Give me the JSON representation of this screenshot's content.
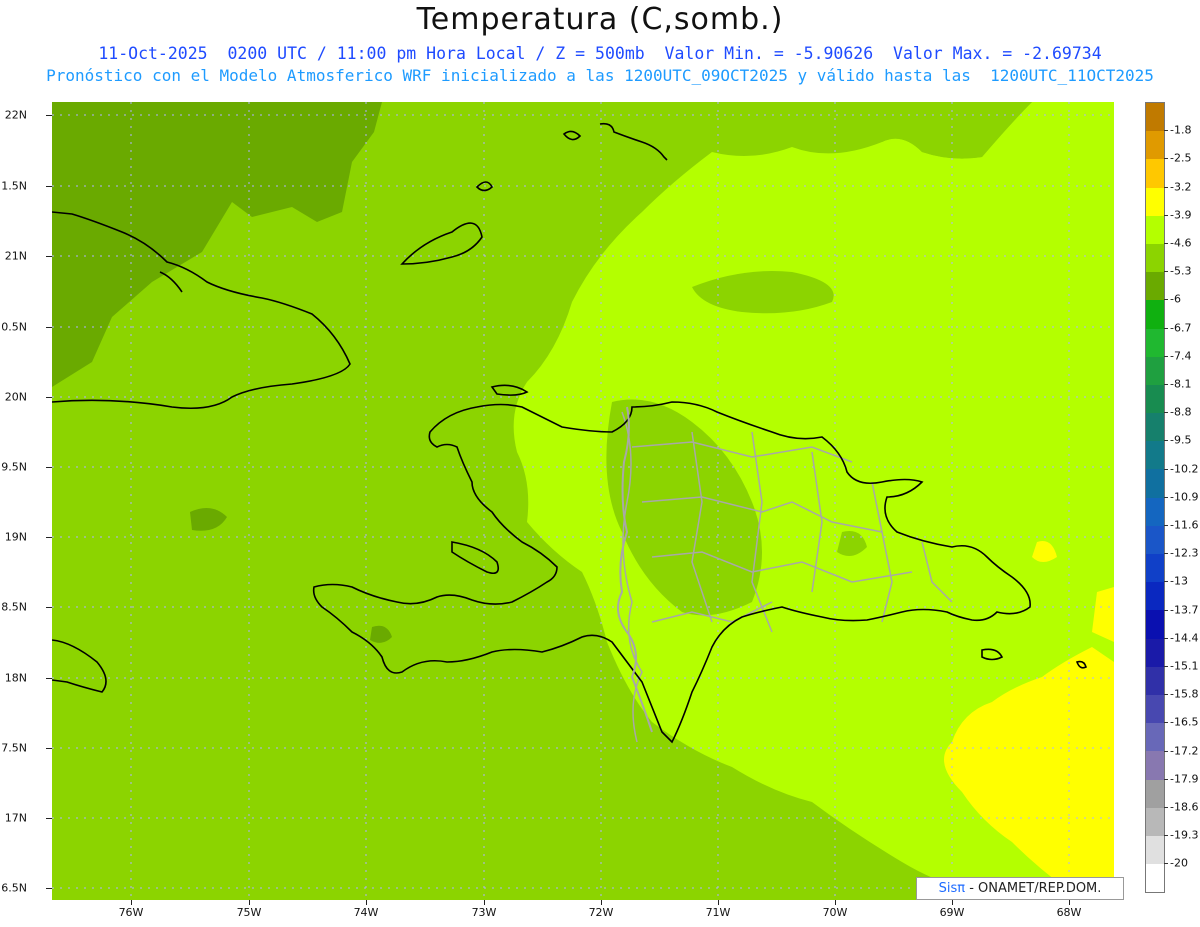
{
  "title": "Temperatura (C,somb.)",
  "subtitle_line1": "11-Oct-2025  0200 UTC / 11:00 pm Hora Local / Z = 500mb  Valor Min. = -5.90626  Valor Max. = -2.69734",
  "subtitle_line2": "Pronóstico con el Modelo Atmosferico WRF inicializado a las 1200UTC_09OCT2025 y válido hasta las  1200UTC_11OCT2025",
  "credit": {
    "brand": "Sisπ",
    "text": " - ONAMET/REP.DOM."
  },
  "y_axis_labels": [
    "22N",
    "1.5N",
    "21N",
    "0.5N",
    "20N",
    "9.5N",
    "19N",
    "8.5N",
    "18N",
    "7.5N",
    "17N",
    "6.5N"
  ],
  "x_axis_labels": [
    "76W",
    "75W",
    "74W",
    "73W",
    "72W",
    "71W",
    "70W",
    "69W",
    "68W"
  ],
  "colorbar": {
    "labels": [
      "-1.8",
      "-2.5",
      "-3.2",
      "-3.9",
      "-4.6",
      "-5.3",
      "-6",
      "-6.7",
      "-7.4",
      "-8.1",
      "-8.8",
      "-9.5",
      "-10.2",
      "-10.9",
      "-11.6",
      "-12.3",
      "-13",
      "-13.7",
      "-14.4",
      "-15.1",
      "-15.8",
      "-16.5",
      "-17.2",
      "-17.9",
      "-18.6",
      "-19.3",
      "-20"
    ],
    "colors": [
      "#c07a00",
      "#e09a00",
      "#ffc800",
      "#ffff00",
      "#b4ff00",
      "#8cd400",
      "#6aaa00",
      "#10b010",
      "#20b830",
      "#1fa040",
      "#188c50",
      "#16806c",
      "#127a8a",
      "#1070a0",
      "#1466c0",
      "#1a56c8",
      "#1040c8",
      "#0a28c0",
      "#0a10b0",
      "#1a1aa8",
      "#3030a8",
      "#4848b0",
      "#6868b8",
      "#8878b0",
      "#a0a0a0",
      "#b8b8b8",
      "#e0e0e0",
      "#ffffff"
    ]
  },
  "map_colors": {
    "green_dark": "#6aaa00",
    "green_mid": "#8cd400",
    "green_light": "#b4ff00",
    "yellow": "#ffff00",
    "coast": "#000000",
    "borders": "#a8a8a8",
    "grid": "#b0b0ff"
  }
}
